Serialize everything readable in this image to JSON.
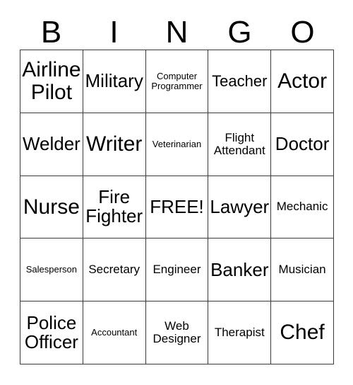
{
  "card": {
    "header_letters": [
      "B",
      "I",
      "N",
      "G",
      "O"
    ],
    "columns": 5,
    "rows": 5,
    "free_space_label": "FREE!",
    "colors": {
      "background": "#ffffff",
      "text": "#000000",
      "grid_line": "#3a3a3a"
    },
    "cells": [
      [
        {
          "label": "Airline Pilot"
        },
        {
          "label": "Military"
        },
        {
          "label": "Computer Programmer"
        },
        {
          "label": "Teacher"
        },
        {
          "label": "Actor"
        }
      ],
      [
        {
          "label": "Welder"
        },
        {
          "label": "Writer"
        },
        {
          "label": "Veterinarian"
        },
        {
          "label": "Flight Attendant"
        },
        {
          "label": "Doctor"
        }
      ],
      [
        {
          "label": "Nurse"
        },
        {
          "label": "Fire Fighter"
        },
        {
          "label": "FREE!"
        },
        {
          "label": "Lawyer"
        },
        {
          "label": "Mechanic"
        }
      ],
      [
        {
          "label": "Salesperson"
        },
        {
          "label": "Secretary"
        },
        {
          "label": "Engineer"
        },
        {
          "label": "Banker"
        },
        {
          "label": "Musician"
        }
      ],
      [
        {
          "label": "Police Officer"
        },
        {
          "label": "Accountant"
        },
        {
          "label": "Web Designer"
        },
        {
          "label": "Therapist"
        },
        {
          "label": "Chef"
        }
      ]
    ]
  }
}
